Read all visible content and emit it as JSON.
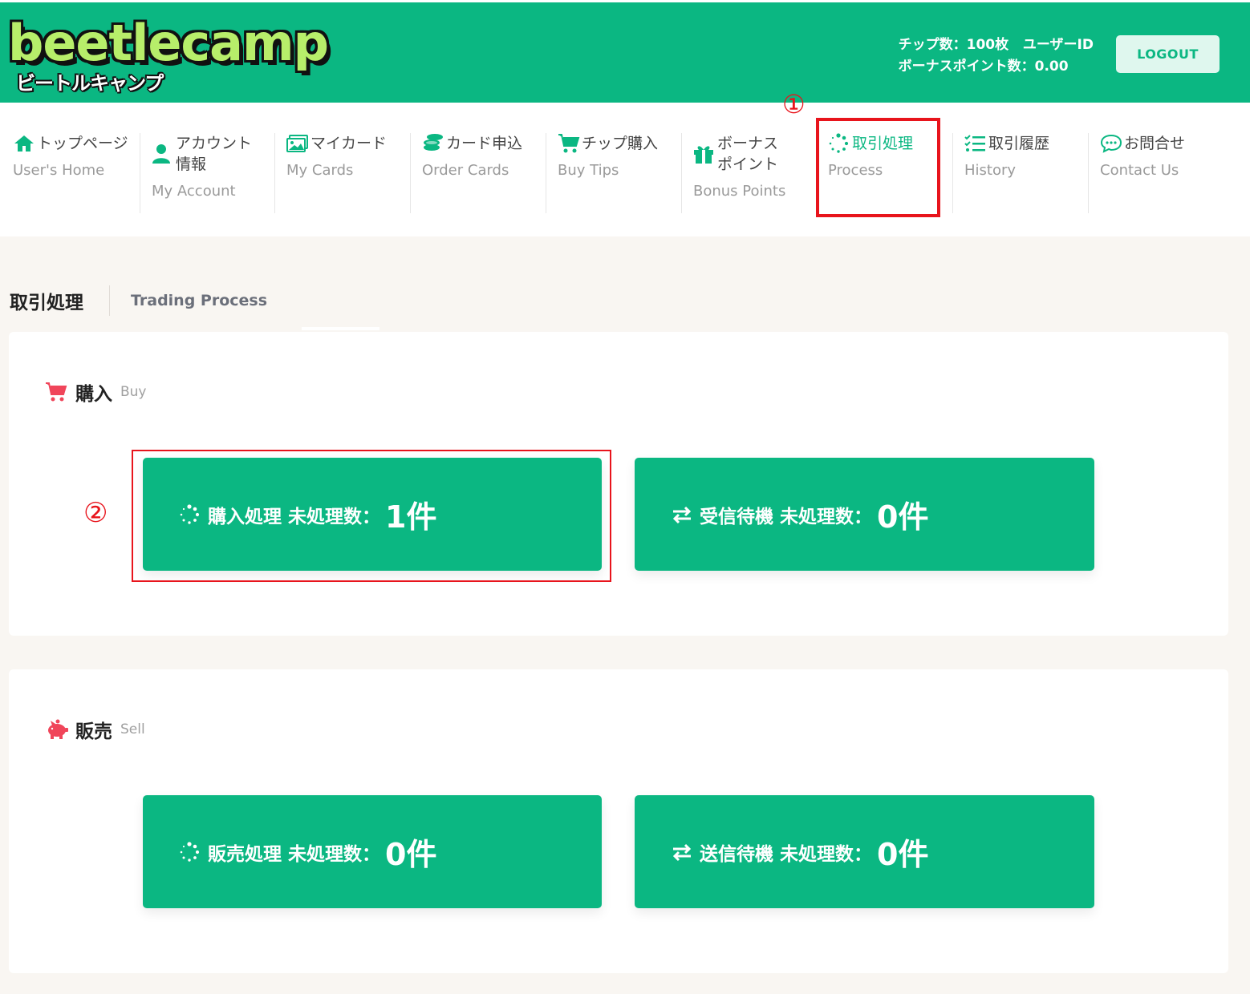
{
  "header": {
    "logo_main": "beetlecamp",
    "logo_sub": "ビートルキャンプ",
    "chips": "チップ数：100枚",
    "user_id_label": "ユーザーID",
    "bonus": "ボーナスポイント数：0.00",
    "logout_label": "LOGOUT"
  },
  "nav": {
    "items": [
      {
        "label": "トップページ",
        "sub": "User's Home",
        "icon": "home-icon"
      },
      {
        "label": "アカウント\n情報",
        "sub": "My Account",
        "icon": "user-icon"
      },
      {
        "label": "マイカード",
        "sub": "My Cards",
        "icon": "image-icon"
      },
      {
        "label": "カード申込",
        "sub": "Order Cards",
        "icon": "coins-icon"
      },
      {
        "label": "チップ購入",
        "sub": "Buy Tips",
        "icon": "cart-icon"
      },
      {
        "label": "ボーナス\nポイント",
        "sub": "Bonus Points",
        "icon": "gift-icon"
      },
      {
        "label": "取引処理",
        "sub": "Process",
        "icon": "spinner-icon",
        "active": true
      },
      {
        "label": "取引履歴",
        "sub": "History",
        "icon": "list-icon"
      },
      {
        "label": "お問合せ",
        "sub": "Contact Us",
        "icon": "chat-icon"
      }
    ]
  },
  "annotations": {
    "one": "①",
    "two": "②"
  },
  "page": {
    "title": "取引処理",
    "title_en": "Trading Process"
  },
  "buy": {
    "title": "購入",
    "title_en": "Buy",
    "buttons": [
      {
        "label": "購入処理 未処理数：",
        "count": "1件"
      },
      {
        "label": "受信待機 未処理数：",
        "count": "0件"
      }
    ]
  },
  "sell": {
    "title": "販売",
    "title_en": "Sell",
    "buttons": [
      {
        "label": "販売処理 未処理数：",
        "count": "0件"
      },
      {
        "label": "送信待機 未処理数：",
        "count": "0件"
      }
    ]
  },
  "colors": {
    "brand": "#0bb782",
    "accent_red": "#e8141c",
    "section_icon": "#f0455a"
  }
}
